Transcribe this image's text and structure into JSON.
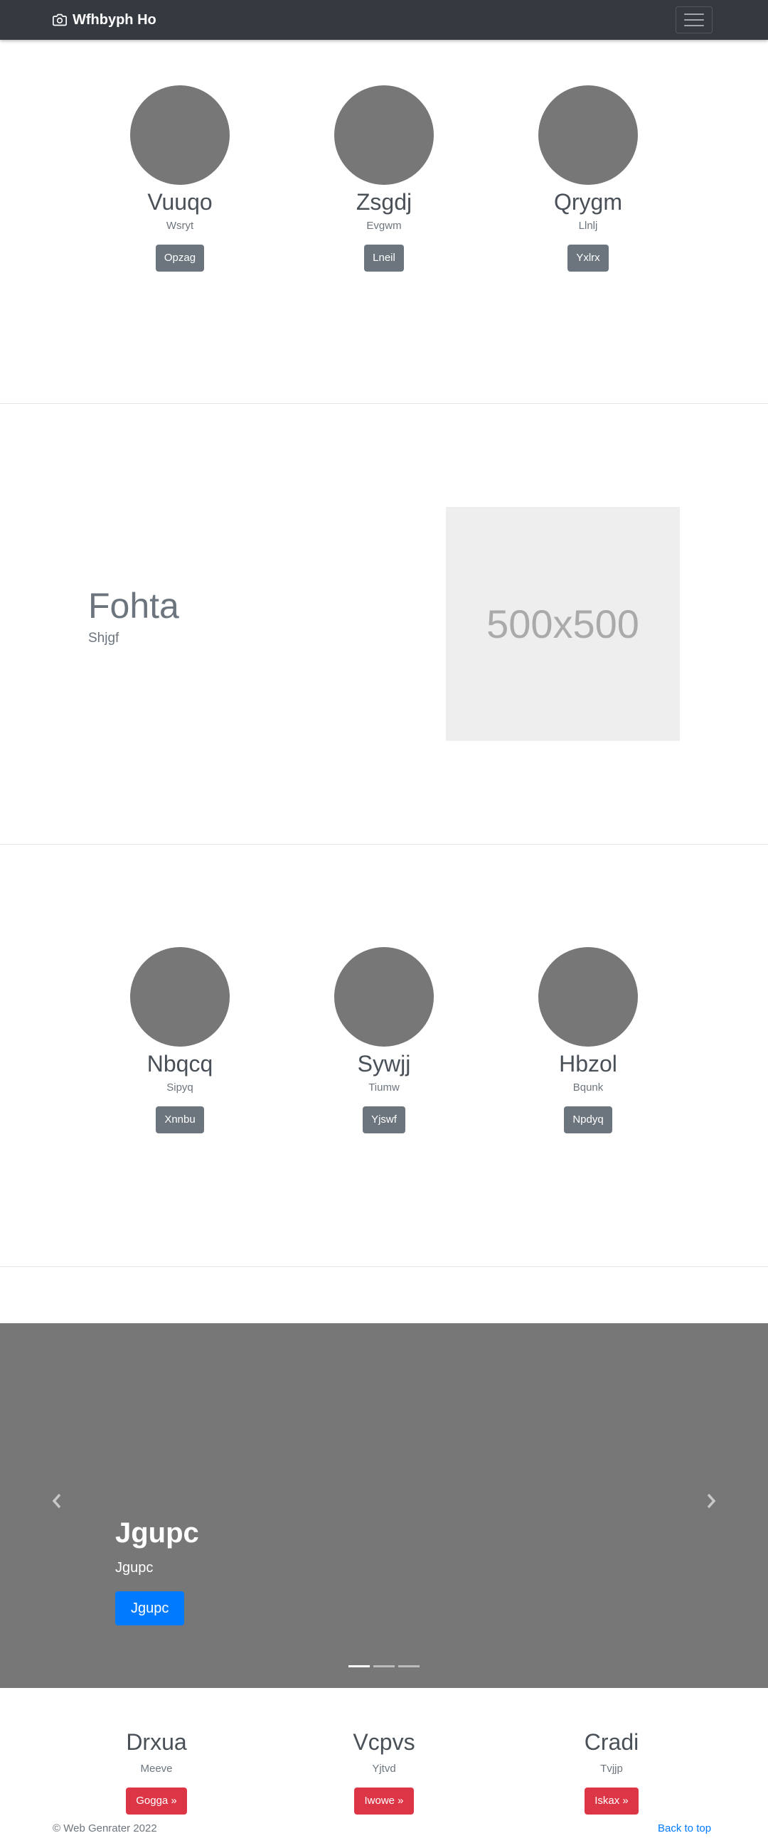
{
  "navbar": {
    "brand": "Wfhbyph Ho",
    "brand_icon": "camera-icon",
    "toggler_icon": "hamburger-icon"
  },
  "team1": [
    {
      "name": "Vuuqo",
      "sub": "Wsryt",
      "button": "Opzag"
    },
    {
      "name": "Zsgdj",
      "sub": "Evgwm",
      "button": "Lneil"
    },
    {
      "name": "Qrygm",
      "sub": "Llnlj",
      "button": "Yxlrx"
    }
  ],
  "feature": {
    "title": "Fohta",
    "subtitle": "Shjgf",
    "image_label": "500x500"
  },
  "team2": [
    {
      "name": "Nbqcq",
      "sub": "Sipyq",
      "button": "Xnnbu"
    },
    {
      "name": "Sywjj",
      "sub": "Tiumw",
      "button": "Yjswf"
    },
    {
      "name": "Hbzol",
      "sub": "Bqunk",
      "button": "Npdyq"
    }
  ],
  "carousel": {
    "title": "Jgupc",
    "subtitle": "Jgupc",
    "button": "Jgupc",
    "slide_count": 3,
    "active_index": 0
  },
  "columns": [
    {
      "title": "Drxua",
      "sub": "Meeve",
      "button": "Gogga »"
    },
    {
      "title": "Vcpvs",
      "sub": "Yjtvd",
      "button": "Iwowe »"
    },
    {
      "title": "Cradi",
      "sub": "Tvjjp",
      "button": "Iskax »"
    }
  ],
  "footer": {
    "copyright": "© Web Genrater 2022",
    "back_to_top": "Back to top"
  },
  "colors": {
    "navbar": "#343a40",
    "secondary_button": "#6c757d",
    "danger_button": "#dc3545",
    "primary_button": "#007bff",
    "avatar": "#777777",
    "carousel_bg": "#777777"
  }
}
